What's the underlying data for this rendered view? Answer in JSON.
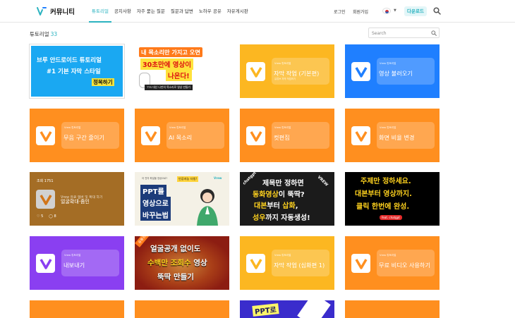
{
  "header": {
    "brand": "커뮤니티",
    "nav": [
      "튜토리얼",
      "공지사항",
      "자주 묻는 질문",
      "질문과 답변",
      "노하우 공유",
      "자유게시판"
    ],
    "active_nav": 0,
    "login": "로그인",
    "signup": "회원가입",
    "language_icon": "korea-flag-icon",
    "download": "다운로드",
    "accent": "#2bb3c0"
  },
  "toolbar": {
    "title": "튜토리얼",
    "count": "33",
    "search_placeholder": "Search"
  },
  "cards": {
    "c0": {
      "l1": "브루 안드로이드 튜토리얼",
      "l2": "#1 기본 자막 스타일",
      "l3": "정복하기"
    },
    "c1": {
      "l1": "내 목소리만 가지고 오면",
      "l2": "30초만에 영상이",
      "l3": "나온다!",
      "l4": "TTS 대신 나만의 목소리로 영상 만들기"
    },
    "c2": {
      "tag": "Vrew 튜토리얼",
      "label": "자막 작업 (기본편)",
      "sub": "유튜브 자막 작업하기"
    },
    "c3": {
      "tag": "Vrew 튜토리얼",
      "label": "영상 불러오기"
    },
    "c4": {
      "tag": "Vrew 튜토리얼",
      "label": "무음 구간 줄이기"
    },
    "c5": {
      "tag": "Vrew 튜토리얼",
      "label": "AI 목소리"
    },
    "c6": {
      "tag": "Vrew 튜토리얼",
      "label": "컷편집"
    },
    "c7": {
      "tag": "Vrew 튜토리얼",
      "label": "화면 비율 변경"
    },
    "c8": {
      "views": "조회 1751",
      "ghost": "Vrew 유료 멤버 및 확대 하기",
      "label": "얼굴확대·줌인",
      "likes": "5",
      "comments": "8"
    },
    "c9": {
      "tiny": "아 전자 파일을 영상으로?",
      "badge": "인공지능 더빙!",
      "l1": "PPT를",
      "l2": "영상으로",
      "l3": "바꾸는법",
      "mark": "Vrew"
    },
    "c10": {
      "tag": "chatgpt",
      "vrew": "VREW",
      "l1": "제목만 정하면",
      "l2a": "동화영상",
      "l2b": "이 뚝딱?",
      "l3a": "대본",
      "l3b": "부터 ",
      "l3c": "삽화",
      "l3d": ",",
      "l4a": "성우",
      "l4b": "까지 자동생성!"
    },
    "c11": {
      "l1": "주제만 정하세요.",
      "l2": "대본부터 영상까지.",
      "l3": "클릭 한번에 완성.",
      "pill": "feat. chatgpt"
    },
    "c12": {
      "tag": "Vrew 튜토리얼",
      "label": "내보내기"
    },
    "c13": {
      "ribbon": "유튜브 기본",
      "l1": "얼굴공개 없이도",
      "l2a": "수백만 조회수",
      "l2b": " 영상",
      "l3": "뚝딱 만들기"
    },
    "c14": {
      "tag": "Vrew 튜토리얼",
      "label": "자막 작업 (심화편 1)"
    },
    "c15": {
      "tag": "Vrew 튜토리얼",
      "label": "무료 비디오 사용하기"
    },
    "c18": {
      "l1": "PPT로"
    }
  }
}
